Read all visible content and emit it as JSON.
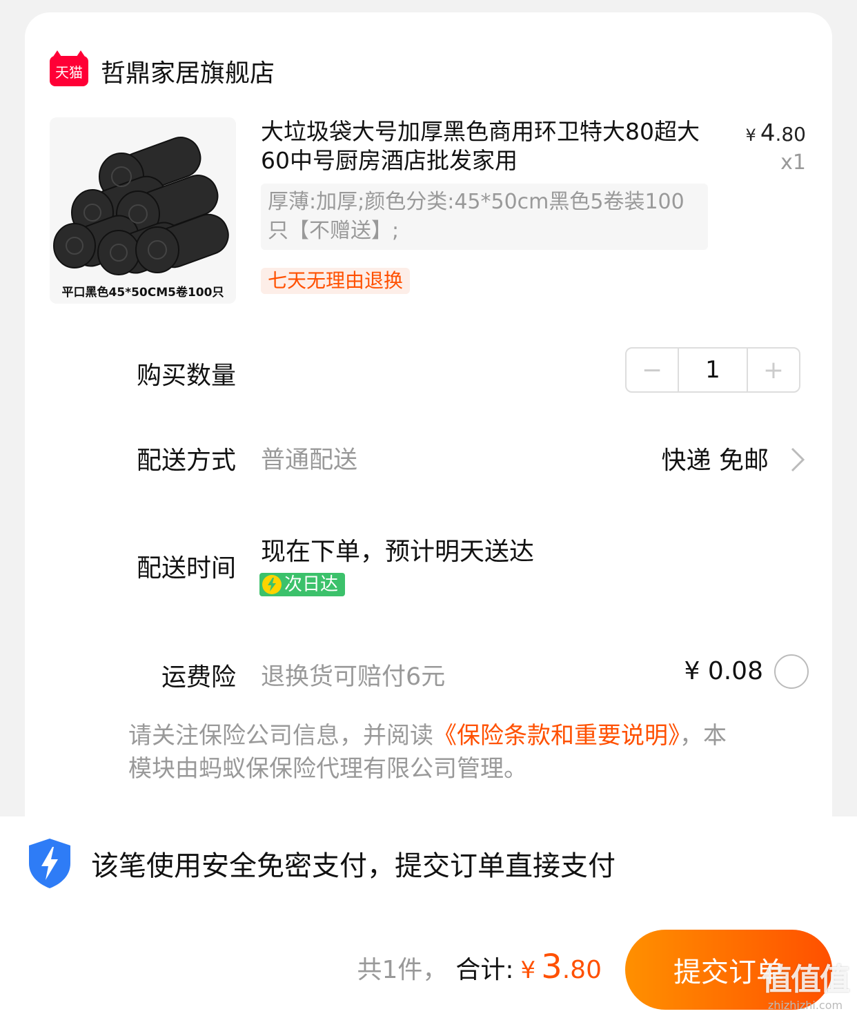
{
  "shop": {
    "badge": "天猫",
    "name": "哲鼎家居旗舰店"
  },
  "product": {
    "image_caption": "平口黑色45*50CM5卷100只",
    "title": "大垃圾袋大号加厚黑色商用环卫特大80超大60中号厨房酒店批发家用",
    "price_currency": "¥",
    "price_int": "4",
    "price_dec": ".80",
    "quantity_label": "x1",
    "sku": "厚薄:加厚;颜色分类:45*50cm黑色5卷装100只【不赠送】;",
    "return_tag": "七天无理由退换"
  },
  "quantity": {
    "label": "购买数量",
    "minus": "−",
    "value": "1",
    "plus": "+"
  },
  "shipping": {
    "label": "配送方式",
    "method": "普通配送",
    "value": "快递 免邮"
  },
  "delivery": {
    "label": "配送时间",
    "eta": "现在下单，预计明天送达",
    "badge": "次日达"
  },
  "insurance": {
    "label": "运费险",
    "desc": "退换货可赔付6元",
    "price": "¥ 0.08"
  },
  "notice": {
    "prefix": "请关注保险公司信息，并阅读",
    "link": "《保险条款和重要说明》",
    "suffix": "，本模块由蚂蚁保保险代理有限公司管理。"
  },
  "footer": {
    "secure_text": "该笔使用安全免密支付，提交订单直接支付",
    "count": "共1件，",
    "total_label": "合计:",
    "currency": "¥",
    "total_int": "3",
    "total_dec": ".80",
    "submit": "提交订单",
    "watermark": "值值值",
    "watermark_url": "zhizhizhi.com"
  },
  "colors": {
    "accent": "#ff5000",
    "tmall_red": "#ff0036",
    "green_badge": "#3cc16b",
    "shield_blue": "#2e7cf6"
  }
}
